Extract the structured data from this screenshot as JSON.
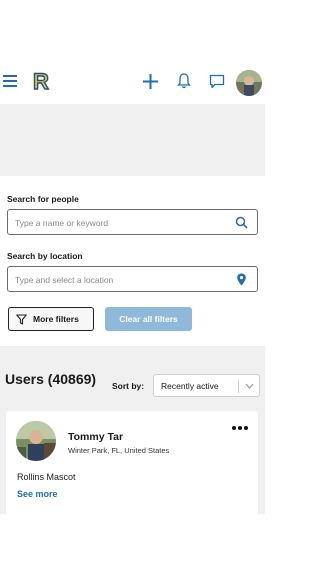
{
  "topbar": {
    "logo_letter": "R",
    "colors": {
      "icon": "#1f6fae",
      "logo_fill": "#f2c230",
      "logo_stroke": "#1f4e8c"
    }
  },
  "search": {
    "people_label": "Search for people",
    "people_placeholder": "Type a name or keyword",
    "location_label": "Search by location",
    "location_placeholder": "Type and select a location",
    "more_filters_label": "More filters",
    "clear_filters_label": "Clear all filters"
  },
  "results": {
    "title": "Users (40869)",
    "sort_label": "Sort by:",
    "sort_value": "Recently active"
  },
  "users": [
    {
      "name": "Tommy Tar",
      "location": "Winter Park, FL, United States",
      "title": "Rollins Mascot",
      "see_more": "See more"
    }
  ]
}
